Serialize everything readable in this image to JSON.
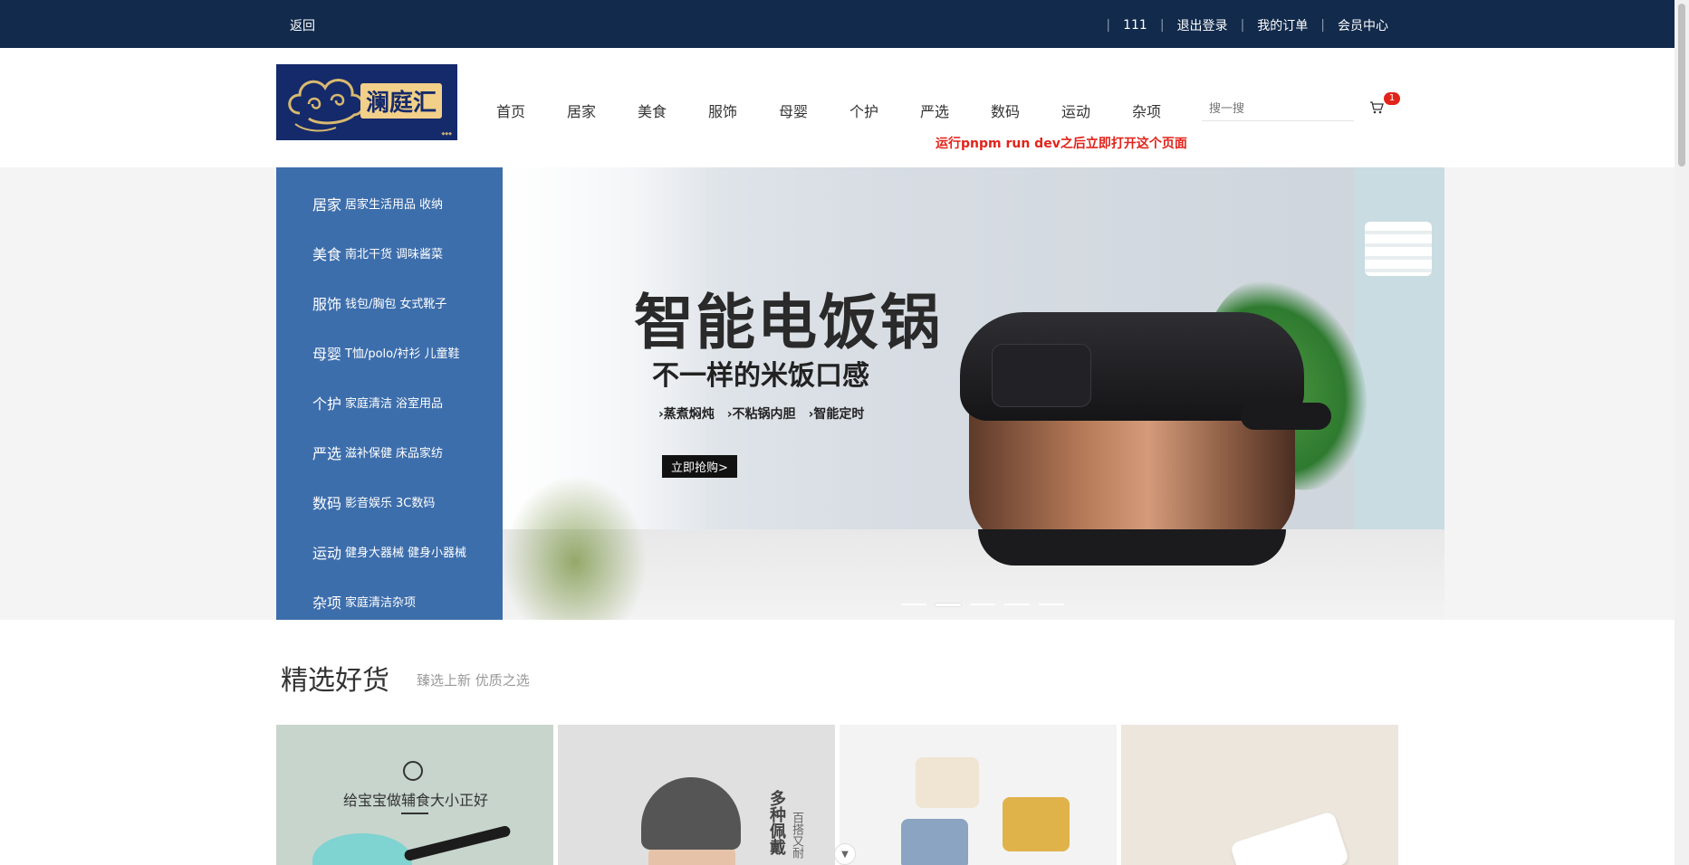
{
  "topbar": {
    "back": "返回",
    "user": "111",
    "logout": "退出登录",
    "orders": "我的订单",
    "member": "会员中心"
  },
  "header": {
    "logo_text": "澜庭汇",
    "nav": [
      "首页",
      "居家",
      "美食",
      "服饰",
      "母婴",
      "个护",
      "严选",
      "数码",
      "运动",
      "杂项"
    ],
    "search_placeholder": "搜一搜",
    "cart_count": "1",
    "notice": "运行pnpm run dev之后立即打开这个页面"
  },
  "categories": [
    {
      "main": "居家",
      "subs": [
        "居家生活用品",
        "收纳"
      ]
    },
    {
      "main": "美食",
      "subs": [
        "南北干货",
        "调味酱菜"
      ]
    },
    {
      "main": "服饰",
      "subs": [
        "钱包/胸包",
        "女式靴子"
      ]
    },
    {
      "main": "母婴",
      "subs": [
        "T恤/polo/衬衫",
        "儿童鞋"
      ]
    },
    {
      "main": "个护",
      "subs": [
        "家庭清洁",
        "浴室用品"
      ]
    },
    {
      "main": "严选",
      "subs": [
        "滋补保健",
        "床品家纺"
      ]
    },
    {
      "main": "数码",
      "subs": [
        "影音娱乐",
        "3C数码"
      ]
    },
    {
      "main": "运动",
      "subs": [
        "健身大器械",
        "健身小器械"
      ]
    },
    {
      "main": "杂项",
      "subs": [
        "家庭清洁杂项"
      ]
    }
  ],
  "banner": {
    "headline": "智能电饭锅",
    "subheadline": "不一样的米饭口感",
    "features": [
      "›蒸煮焖炖",
      "›不粘锅内胆",
      "›智能定时"
    ],
    "cta": "立即抢购>",
    "slide_count": 5,
    "active_slide": 2
  },
  "section": {
    "title": "精选好货",
    "subtitle": "臻选上新 优质之选"
  },
  "products": [
    {
      "caption": "给宝宝做辅食大小正好"
    },
    {
      "vertical_text": "多种佩戴",
      "vertical_text2": "百搭又耐"
    },
    {},
    {}
  ],
  "colors": {
    "topbar": "#122a4b",
    "category_bg": "#3d6eac",
    "notice": "#e2231a",
    "badge": "#e2231a"
  }
}
